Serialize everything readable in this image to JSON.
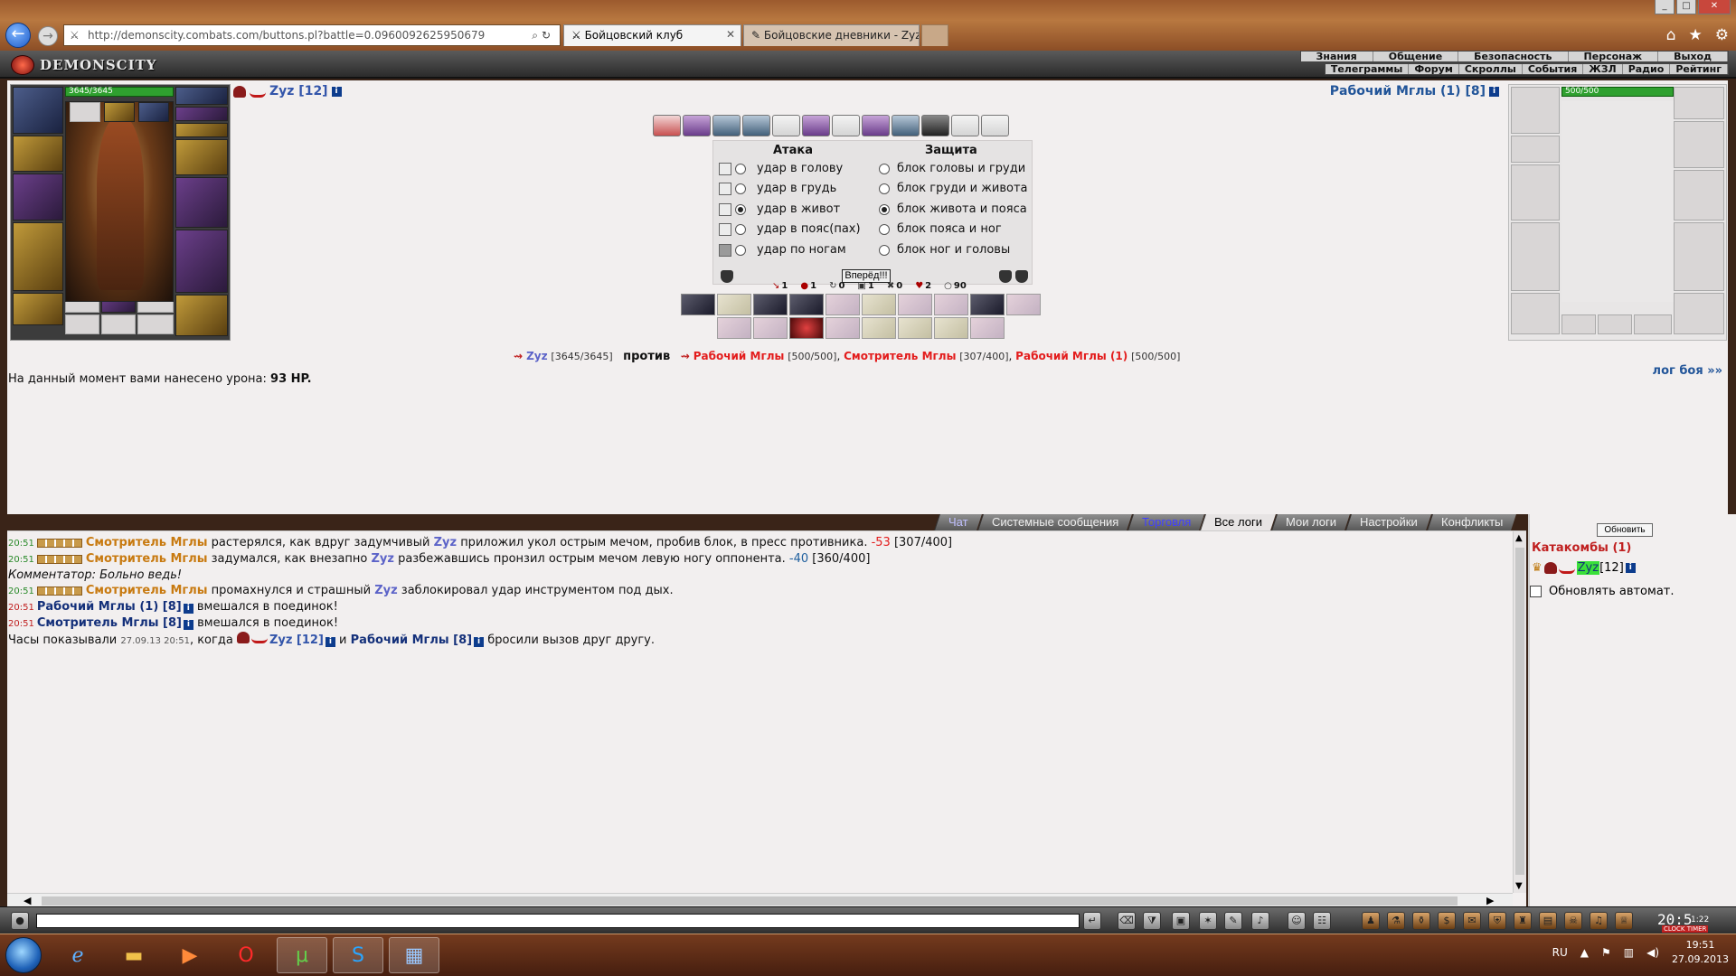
{
  "browser": {
    "url": "http://demonscity.combats.com/buttons.pl?battle=0.0960092625950679",
    "tabs": [
      {
        "label": "Бойцовский клуб"
      },
      {
        "label": "Бойцовские дневники - Zyz - ..."
      }
    ]
  },
  "game": {
    "brand": "DEMONSCITY",
    "menu_top": [
      "Знания",
      "Общение",
      "Безопасность",
      "Персонаж",
      "Выход"
    ],
    "menu_bottom": [
      "Телеграммы",
      "Форум",
      "Скроллы",
      "События",
      "ЖЗЛ",
      "Радио",
      "Рейтинг"
    ]
  },
  "battle": {
    "left_player": {
      "name": "Zyz [12]",
      "hp": "3645/3645",
      "hp_fraction": 1.0
    },
    "right_player": {
      "name": "Рабочий Мглы (1) [8]",
      "hp": "500/500",
      "hp_fraction": 1.0
    },
    "attack_title": "Атака",
    "defense_title": "Защита",
    "attacks": [
      {
        "label": "удар в голову",
        "selected": false
      },
      {
        "label": "удар в грудь",
        "selected": false
      },
      {
        "label": "удар в живот",
        "selected": true
      },
      {
        "label": "удар в пояс(пах)",
        "selected": false
      },
      {
        "label": "удар по ногам",
        "selected": false
      }
    ],
    "defenses": [
      {
        "label": "блок головы и груди",
        "selected": false
      },
      {
        "label": "блок груди и живота",
        "selected": false
      },
      {
        "label": "блок живота и пояса",
        "selected": true
      },
      {
        "label": "блок пояса и ног",
        "selected": false
      },
      {
        "label": "блок ног и головы",
        "selected": false
      }
    ],
    "go_button": "Вперёд!!!",
    "stats": [
      {
        "icon": "strike",
        "value": "1"
      },
      {
        "icon": "blood",
        "value": "1"
      },
      {
        "icon": "counter",
        "value": "0"
      },
      {
        "icon": "block",
        "value": "1"
      },
      {
        "icon": "crit",
        "value": "0"
      },
      {
        "icon": "heart",
        "value": "2"
      },
      {
        "icon": "spirit",
        "value": "90"
      }
    ],
    "vs": {
      "me": "Zyz",
      "me_hp": "[3645/3645]",
      "vs_word": "против",
      "enemies": [
        {
          "name": "Рабочий Мглы",
          "hp": "[500/500]"
        },
        {
          "name": "Смотритель Мглы",
          "hp": "[307/400]"
        },
        {
          "name": "Рабочий Мглы (1)",
          "hp": "[500/500]"
        }
      ]
    },
    "damage_text": "На данный момент вами нанесено урона:",
    "damage_value": "93 HP.",
    "log_link": "лог боя »»"
  },
  "chat": {
    "tabs": [
      "Чат",
      "Системные сообщения",
      "Торговля",
      "Все логи",
      "Мои логи",
      "Настройки",
      "Конфликты"
    ],
    "selected_tab": "Все логи",
    "messages": [
      {
        "time": "20:51",
        "actor": "Смотритель Мглы",
        "text1": "растерялся, как вдруг задумчивый",
        "target": "Zyz",
        "text2": "приложил укол острым мечом, пробив блок, в пресс противника.",
        "delta": "-53",
        "hp": "[307/400]"
      },
      {
        "time": "20:51",
        "actor": "Смотритель Мглы",
        "text1": "задумался, как внезапно",
        "target": "Zyz",
        "text2": "разбежавшись пронзил острым мечом левую ногу оппонента.",
        "delta": "-40",
        "hp": "[360/400]"
      },
      {
        "comment": "Комментатор: Больно ведь!"
      },
      {
        "time": "20:51",
        "actor": "Смотритель Мглы",
        "text1": "промахнулся и страшный",
        "target": "Zyz",
        "text2": "заблокировал удар инструментом под дых."
      },
      {
        "time": "20:51",
        "joiner": "Рабочий Мглы (1) [8]",
        "text": "вмешался в поединок!"
      },
      {
        "time": "20:51",
        "joiner": "Смотритель Мглы [8]",
        "text": "вмешался в поединок!"
      }
    ],
    "challenge": {
      "prefix": "Часы показывали",
      "datetime": "27.09.13 20:51",
      "when": ", когда",
      "p1": "Zyz [12]",
      "and": "и",
      "p2": "Рабочий Мглы [8]",
      "suffix": "бросили вызов друг другу."
    }
  },
  "side": {
    "refresh": "Обновить",
    "location": "Катакомбы (1)",
    "player": "Zyz",
    "level": "[12]",
    "auto": "Обновлять автомат."
  },
  "bottombar": {
    "clock": "20:5",
    "clock_small": "1:22",
    "clock_labels": "CLOCK TIMER"
  },
  "taskbar": {
    "lang": "RU",
    "time": "19:51",
    "date": "27.09.2013"
  }
}
